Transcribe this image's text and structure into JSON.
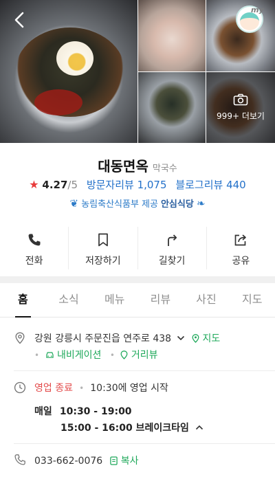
{
  "header": {
    "more_photos_label": "999+ 더보기",
    "my_badge_text": "my"
  },
  "place": {
    "name": "대동면옥",
    "category": "막국수",
    "rating": "4.27",
    "rating_max": "/5",
    "visitor_reviews": "방문자리뷰 1,075",
    "blog_reviews": "블로그리뷰 440",
    "certification": {
      "prefix": "농림축산식품부 제공",
      "name": "안심식당"
    }
  },
  "actions": [
    {
      "label": "전화",
      "icon": "phone-icon"
    },
    {
      "label": "저장하기",
      "icon": "bookmark-icon"
    },
    {
      "label": "길찾기",
      "icon": "directions-icon"
    },
    {
      "label": "공유",
      "icon": "share-icon"
    }
  ],
  "tabs": [
    {
      "label": "홈",
      "active": true
    },
    {
      "label": "소식",
      "active": false
    },
    {
      "label": "메뉴",
      "active": false
    },
    {
      "label": "리뷰",
      "active": false
    },
    {
      "label": "사진",
      "active": false
    },
    {
      "label": "지도",
      "active": false
    }
  ],
  "address": {
    "text": "강원 강릉시 주문진읍 연주로 438",
    "map_link": "지도",
    "navigation": "내비게이션",
    "street_view": "거리뷰"
  },
  "hours": {
    "status": "영업 종료",
    "next": "10:30에 영업 시작",
    "day_label": "매일",
    "open_time": "10:30 - 19:00",
    "break_time": "15:00 - 16:00 브레이크타임"
  },
  "contact": {
    "phone": "033-662-0076",
    "copy_label": "복사"
  },
  "colors": {
    "accent_green": "#1ea85a",
    "link_blue": "#2270c9",
    "closed_red": "#e34b4b",
    "star_red": "#e83b3b"
  }
}
